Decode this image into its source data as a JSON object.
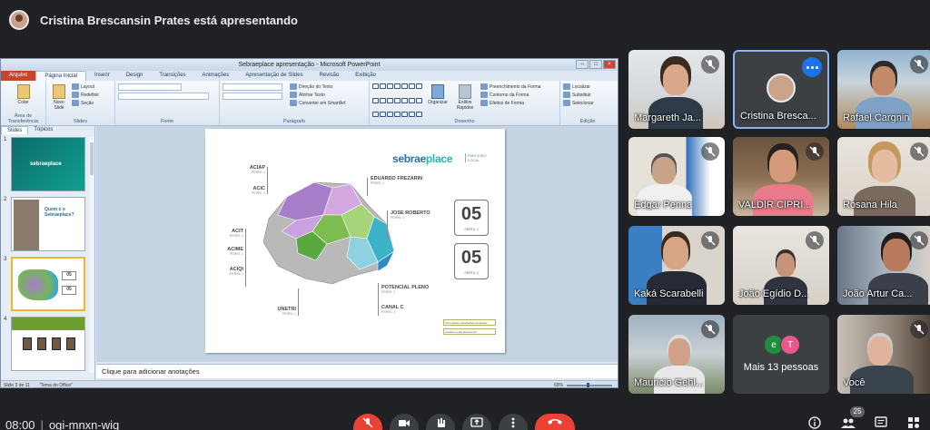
{
  "presenter": {
    "name": "Cristina Brescansin Prates está apresentando"
  },
  "ppt": {
    "window_title": "Sebraeplace apresentação - Microsoft PowerPoint",
    "tabs": [
      "Arquivo",
      "Página Inicial",
      "Inserir",
      "Design",
      "Transições",
      "Animações",
      "Apresentação de Slides",
      "Revisão",
      "Exibição"
    ],
    "ribbon": {
      "clipboard": {
        "paste": "Colar",
        "label": "Área de Transferência"
      },
      "slides": {
        "new_slide": "Novo Slide",
        "layout": "Layout",
        "reset": "Redefinir",
        "section": "Seção",
        "label": "Slides"
      },
      "font": {
        "label": "Fonte"
      },
      "paragraph": {
        "direction": "Direção do Texto",
        "align": "Alinhar Texto",
        "smartart": "Converter em SmartArt",
        "label": "Parágrafo"
      },
      "drawing": {
        "arrange": "Organizar",
        "styles": "Estilos Rápidos",
        "fill": "Preenchimento da Forma",
        "outline": "Contorno da Forma",
        "effects": "Efeitos de Forma",
        "label": "Desenho"
      },
      "editing": {
        "find": "Localizar",
        "replace": "Substituir",
        "select": "Selecionar",
        "label": "Edição"
      }
    },
    "pane_tabs": [
      "Slides",
      "Tópicos"
    ],
    "thumbnails": [
      {
        "num": "1",
        "text": "sebraeplace"
      },
      {
        "num": "2",
        "text": "Quem é o Sebraeplace?"
      },
      {
        "num": "3",
        "text": "05"
      },
      {
        "num": "4",
        "text": ""
      }
    ],
    "slide": {
      "logo_a": "sebrae",
      "logo_b": "place",
      "tag": "PARCEIRO LOCAL",
      "cities_left": [
        {
          "name": "ACIAP",
          "sub": "PERFIL 1"
        },
        {
          "name": "ACIC",
          "sub": "PERFIL 1"
        },
        {
          "name": "ACIT",
          "sub": "PERFIL 1"
        },
        {
          "name": "ACIME",
          "sub": "PERFIL 1"
        },
        {
          "name": "ACIQI",
          "sub": "PERFIL 1"
        },
        {
          "name": "UNETRI",
          "sub": "PERFIL 1"
        }
      ],
      "cities_right": [
        {
          "name": "EDUARDO FREZARIN",
          "sub": "PERFIL 1"
        },
        {
          "name": "JOSE ROBERTO",
          "sub": "PERFIL 1"
        },
        {
          "name": "POTENCIAL PLENO",
          "sub": "PERFIL 1"
        },
        {
          "name": "CANAL C",
          "sub": "PERFIL 1"
        }
      ],
      "perfil1": {
        "value": "05",
        "label": "PERFIL 1"
      },
      "perfil2": {
        "value": "05",
        "label": "PERFIL 2"
      },
      "legend1": "Informações detalhadas completas",
      "legend2": "Gestão pronta ativamente"
    },
    "notes_placeholder": "Clique para adicionar anotações",
    "status": {
      "slide": "Slide 3 de 11",
      "theme": "\"Tema do Office\"",
      "zoom": "69%"
    }
  },
  "participants": [
    {
      "name": "Margareth Ja...",
      "muted": true
    },
    {
      "name": "Cristina Bresca...",
      "muted": false
    },
    {
      "name": "Rafael Cargnin",
      "muted": true
    },
    {
      "name": "Edgar Penna",
      "muted": true
    },
    {
      "name": "VALDIR CIPRI...",
      "muted": true
    },
    {
      "name": "Rosana Hila",
      "muted": true
    },
    {
      "name": "Kaká Scarabelli",
      "muted": true
    },
    {
      "name": "João Egídio D...",
      "muted": true
    },
    {
      "name": "João Artur Ca...",
      "muted": true
    },
    {
      "name": "Mauricio Gehl...",
      "muted": true
    },
    {
      "name": "Você",
      "muted": true
    }
  ],
  "others": {
    "label": "Mais 13 pessoas",
    "initials": [
      "e",
      "T"
    ],
    "colors": [
      "#1e8e3e",
      "#e8588b"
    ]
  },
  "bottom": {
    "time": "08:00",
    "meeting_code": "ogi-mnxn-wiq",
    "people_count": "25"
  },
  "colors": {
    "background": "#202124",
    "tile": "#3c4043",
    "end_call": "#ea4335",
    "accent": "#8ab4f8"
  }
}
